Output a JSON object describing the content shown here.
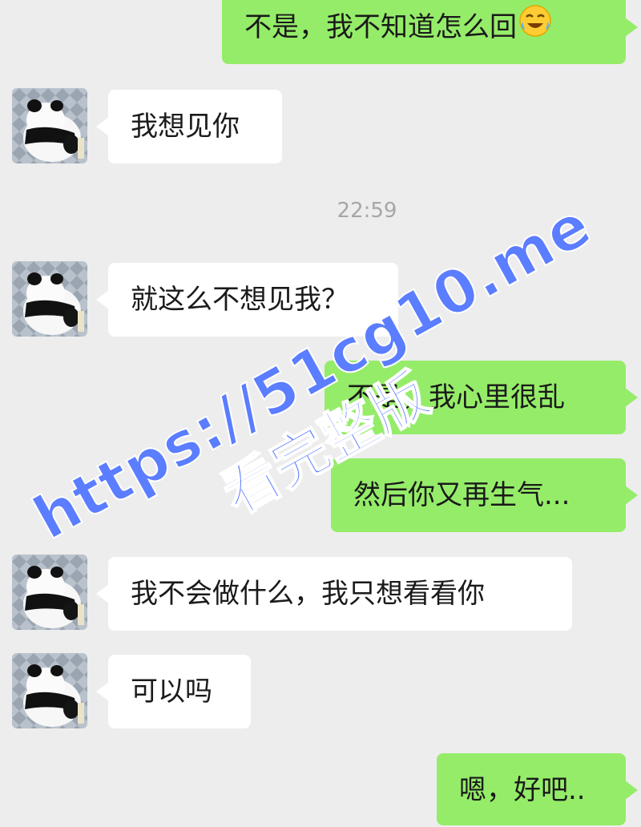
{
  "chat": {
    "timestamp": "22:59",
    "messages": [
      {
        "side": "out",
        "text": "不是，我不知道怎么回",
        "emoji": "crying-laughing-emoji"
      },
      {
        "side": "in",
        "text": "我想见你"
      },
      {
        "side": "in",
        "text": "就这么不想见我？"
      },
      {
        "side": "out",
        "text": "不是，我心里很乱"
      },
      {
        "side": "out",
        "text": "然后你又再生气..."
      },
      {
        "side": "in",
        "text": "我不会做什么，我只想看看你"
      },
      {
        "side": "in",
        "text": "可以吗"
      },
      {
        "side": "out",
        "text": "嗯，好吧.."
      }
    ]
  },
  "contact": {
    "avatar": "panda-avatar"
  },
  "watermark": {
    "url": "https://51cg10.me",
    "text": "看完整版"
  },
  "colors": {
    "background": "#ededed",
    "incoming_bubble": "#ffffff",
    "outgoing_bubble": "#95ec69",
    "watermark": "#5b7dff"
  }
}
